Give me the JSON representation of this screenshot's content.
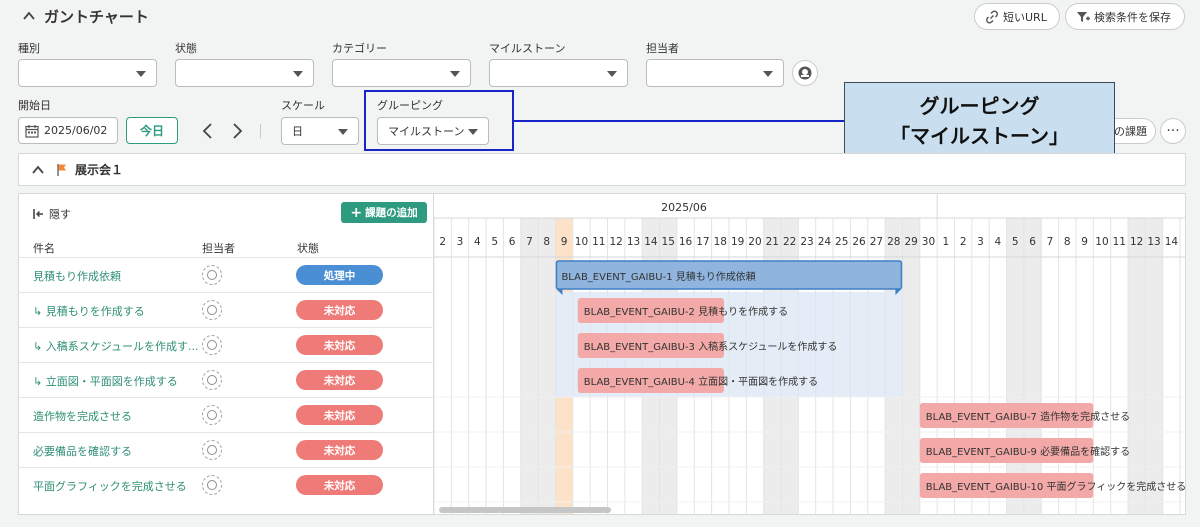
{
  "header": {
    "title": "ガントチャート",
    "short_url_label": "短いURL",
    "save_search_label": "検索条件を保存"
  },
  "filters": {
    "type_label": "種別",
    "status_label": "状態",
    "category_label": "カテゴリー",
    "milestone_label": "マイルストーン",
    "assignee_label": "担当者",
    "start_date_label": "開始日",
    "start_date_value": "2025/06/02",
    "today_label": "今日",
    "scale_label": "スケール",
    "scale_value": "日",
    "grouping_label": "グルーピング",
    "grouping_value": "マイルストーン",
    "partial_button_label": "の課題",
    "more_label": "···"
  },
  "callout": {
    "line1": "グルーピング",
    "line2": "「マイルストーン」"
  },
  "group": {
    "title": "展示会１",
    "flag_color": "#f08a3c"
  },
  "left_pane": {
    "hide_label": "隠す",
    "add_label": "課題の追加",
    "col_name": "件名",
    "col_assignee": "担当者",
    "col_status": "状態"
  },
  "rows": [
    {
      "name": "見積もり作成依頼",
      "sub": false,
      "status": "処理中",
      "status_color": "#4a8fd4"
    },
    {
      "name": "見積もりを作成する",
      "sub": true,
      "status": "未対応",
      "status_color": "#ee7b78"
    },
    {
      "name": "入稿系スケジュールを作成す...",
      "sub": true,
      "status": "未対応",
      "status_color": "#ee7b78"
    },
    {
      "name": "立面図・平面図を作成する",
      "sub": true,
      "status": "未対応",
      "status_color": "#ee7b78"
    },
    {
      "name": "造作物を完成させる",
      "sub": false,
      "status": "未対応",
      "status_color": "#ee7b78"
    },
    {
      "name": "必要備品を確認する",
      "sub": false,
      "status": "未対応",
      "status_color": "#ee7b78"
    },
    {
      "name": "平面グラフィックを完成させる",
      "sub": false,
      "status": "未対応",
      "status_color": "#ee7b78"
    }
  ],
  "timeline": {
    "month_label": "2025/06",
    "days": [
      "2",
      "3",
      "4",
      "5",
      "6",
      "7",
      "8",
      "9",
      "10",
      "11",
      "12",
      "13",
      "14",
      "15",
      "16",
      "17",
      "18",
      "19",
      "20",
      "21",
      "22",
      "23",
      "24",
      "25",
      "26",
      "27",
      "28",
      "29",
      "30",
      "1",
      "2",
      "3",
      "4",
      "5",
      "6",
      "7",
      "8",
      "9",
      "10",
      "11",
      "12",
      "13",
      "14"
    ],
    "weekend_days": [
      7,
      8,
      14,
      15,
      21,
      22,
      28,
      29,
      5,
      6,
      12,
      13
    ],
    "today_index": 7,
    "bars": [
      {
        "row": 0,
        "start": 7,
        "end": 26,
        "label": "BLAB_EVENT_GAIBU-1  見積もり作成依頼",
        "kind": "parent"
      },
      {
        "row": 1,
        "start": 8,
        "end": 16,
        "label": "BLAB_EVENT_GAIBU-2  見積もりを作成する",
        "kind": "child"
      },
      {
        "row": 2,
        "start": 8,
        "end": 16,
        "label": "BLAB_EVENT_GAIBU-3  入稿系スケジュールを作成する",
        "kind": "child"
      },
      {
        "row": 3,
        "start": 8,
        "end": 16,
        "label": "BLAB_EVENT_GAIBU-4  立面図・平面図を作成する",
        "kind": "child"
      },
      {
        "row": 4,
        "start": 28,
        "end": 37,
        "label": "BLAB_EVENT_GAIBU-7  造作物を完成させる",
        "kind": "plain"
      },
      {
        "row": 5,
        "start": 28,
        "end": 37,
        "label": "BLAB_EVENT_GAIBU-9  必要備品を確認する",
        "kind": "plain"
      },
      {
        "row": 6,
        "start": 28,
        "end": 37,
        "label": "BLAB_EVENT_GAIBU-10  平面グラフィックを完成させる",
        "kind": "plain"
      }
    ],
    "colors": {
      "parent_fill": "#8fb4de",
      "parent_stroke": "#3e7fc5",
      "child_fill": "#f3a9a7",
      "range_fill": "#e3ecf7",
      "weekend_fill": "#ececec",
      "today_fill": "#fbe2c8"
    }
  }
}
